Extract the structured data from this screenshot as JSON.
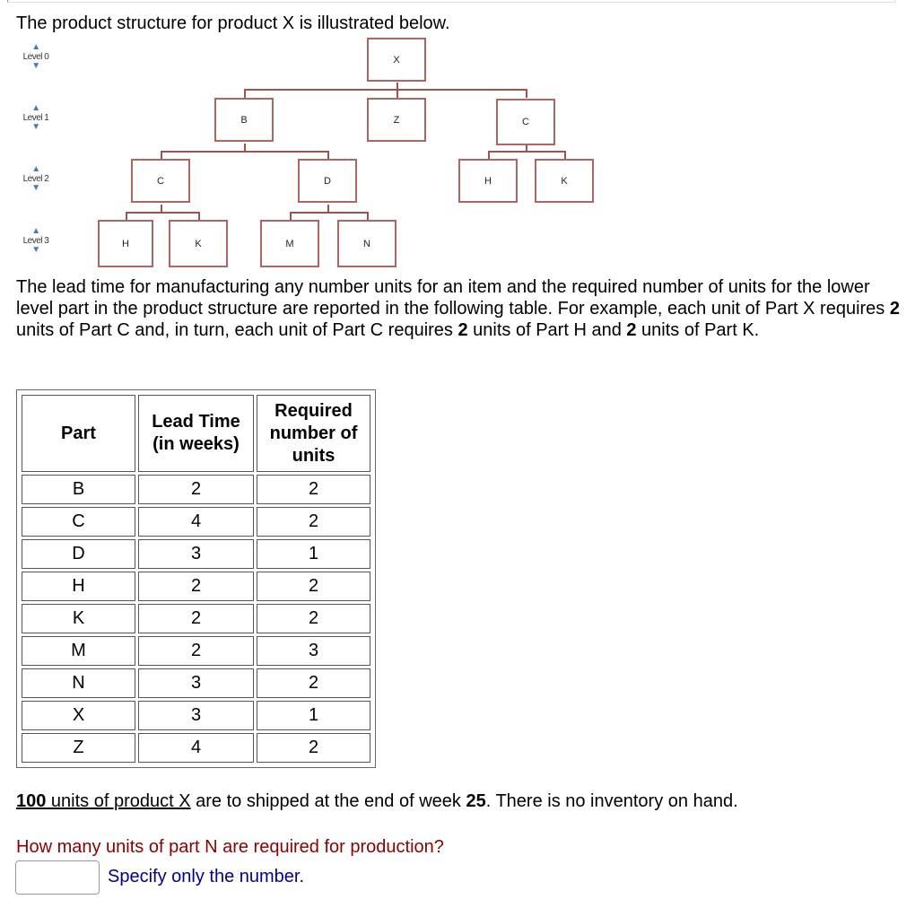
{
  "intro": "The product structure for product X is illustrated below.",
  "diagram": {
    "levels": [
      "Level 0",
      "Level 1",
      "Level 2",
      "Level 3"
    ],
    "nodes": [
      {
        "id": "X",
        "label": "X",
        "level": 0,
        "parent": null
      },
      {
        "id": "B",
        "label": "B",
        "level": 1,
        "parent": "X"
      },
      {
        "id": "Z",
        "label": "Z",
        "level": 1,
        "parent": "X"
      },
      {
        "id": "C1",
        "label": "C",
        "level": 1,
        "parent": "X"
      },
      {
        "id": "C2",
        "label": "C",
        "level": 2,
        "parent": "B"
      },
      {
        "id": "D",
        "label": "D",
        "level": 2,
        "parent": "B"
      },
      {
        "id": "H2",
        "label": "H",
        "level": 2,
        "parent": "C1"
      },
      {
        "id": "K2",
        "label": "K",
        "level": 2,
        "parent": "C1"
      },
      {
        "id": "H3",
        "label": "H",
        "level": 3,
        "parent": "C2"
      },
      {
        "id": "K3",
        "label": "K",
        "level": 3,
        "parent": "C2"
      },
      {
        "id": "M",
        "label": "M",
        "level": 3,
        "parent": "D"
      },
      {
        "id": "N",
        "label": "N",
        "level": 3,
        "parent": "D"
      }
    ]
  },
  "description": {
    "p1": "The lead time for manufacturing any number units for an item and the required number of units for the lower level part in the product structure are reported in the following table. For example, each unit of Part X requires ",
    "b1": "2",
    "p2": " units of Part C and, in turn, each unit of Part C requires ",
    "b2": "2",
    "p3": " units of Part H and ",
    "b3": "2",
    "p4": " units of Part K."
  },
  "table": {
    "headers": [
      "Part",
      "Lead Time (in weeks)",
      "Required number of units"
    ],
    "rows": [
      [
        "B",
        "2",
        "2"
      ],
      [
        "C",
        "4",
        "2"
      ],
      [
        "D",
        "3",
        "1"
      ],
      [
        "H",
        "2",
        "2"
      ],
      [
        "K",
        "2",
        "2"
      ],
      [
        "M",
        "2",
        "3"
      ],
      [
        "N",
        "3",
        "2"
      ],
      [
        "X",
        "3",
        "1"
      ],
      [
        "Z",
        "4",
        "2"
      ]
    ]
  },
  "given": {
    "qty": "100",
    "units_of": " units of product X",
    "rest1": " are to shipped at the end of week ",
    "week": "25",
    "rest2": ". There is no inventory on hand."
  },
  "question": {
    "text": "How many units of part N are required for production?",
    "answer_value": "",
    "hint": "Specify only the number."
  }
}
